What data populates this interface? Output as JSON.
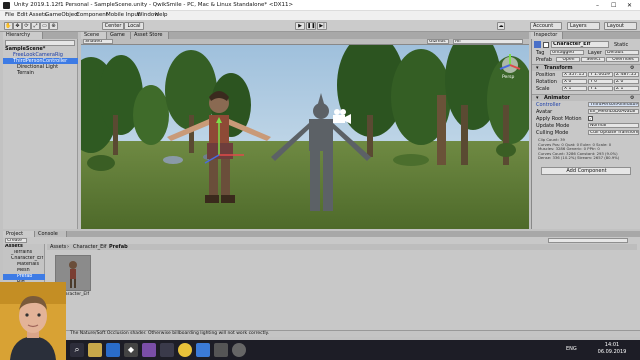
{
  "window": {
    "title": "Unity 2019.1.12f1 Personal - SampleScene.unity - QwikSmile - PC, Mac & Linux Standalone* <DX11>"
  },
  "menu": [
    "File",
    "Edit",
    "Assets",
    "GameObject",
    "Component",
    "Mobile Input",
    "Window",
    "Help"
  ],
  "toolbar": {
    "pivot": "Center",
    "space": "Local",
    "account": "Account",
    "layers": "Layers",
    "layout": "Layout"
  },
  "hierarchy": {
    "tab": "Hierarchy",
    "items": [
      "SampleScene*",
      "FreeLookCameraRig",
      "ThirdPersonController",
      "Directional Light",
      "Terrain"
    ]
  },
  "scene_tabs": [
    "Scene",
    "Game",
    "Asset Store"
  ],
  "scene_toolbar": {
    "shading": "Shaded",
    "gizmos": "Gizmos",
    "search": "All"
  },
  "scene_gizmo": "Persp",
  "inspector": {
    "tab": "Inspector",
    "object_name": "Character_Elf",
    "static_label": "Static",
    "tag_label": "Tag",
    "tag_value": "Untagged",
    "layer_label": "Layer",
    "layer_value": "Default",
    "prefab_label": "Prefab",
    "prefab_open": "Open",
    "prefab_select": "Select",
    "prefab_overrides": "Overrides",
    "transform_title": "Transform",
    "position_label": "Position",
    "position": {
      "x": "X 357.15",
      "y": "Y 1.0029",
      "z": "Z 487.55"
    },
    "rotation_label": "Rotation",
    "rotation": {
      "x": "X 0",
      "y": "Y 0",
      "z": "Z 0"
    },
    "scale_label": "Scale",
    "scale": {
      "x": "X 1",
      "y": "Y 1",
      "z": "Z 1"
    },
    "animator_title": "Animator",
    "controller_label": "Controller",
    "controller_value": "ThirdPersonAnimatorController",
    "avatar_label": "Avatar",
    "avatar_value": "Elf_MeshLoD0Avatar",
    "root_motion_label": "Apply Root Motion",
    "update_mode_label": "Update Mode",
    "update_mode_value": "Normal",
    "culling_label": "Culling Mode",
    "culling_value": "Cull Update Transforms",
    "clip_info": [
      "Clip Count: 39",
      "Curves Pos: 0 Quat: 0 Euler: 0 Scale: 0",
      "Muscles: 3286 Generic: 0 PPtr: 0",
      "Curves Count: 3286 Constant: 293 (9.0%)",
      "Dense: 336 (10.2%) Stream: 2657 (80.9%)"
    ],
    "add_component": "Add Component"
  },
  "project": {
    "tabs": [
      "Project",
      "Console"
    ],
    "create": "Create",
    "breadcrumb": [
      "Assets",
      "Character_Elf",
      "Prefab"
    ],
    "tree": [
      "Assets",
      "_Terrains",
      "Character_Elf",
      "Materials",
      "Mesh",
      "Prefab",
      "Rig",
      "Island",
      "Standard Assets"
    ],
    "asset_label": "Character_Elf"
  },
  "status": {
    "message": "The Nature/Soft Occlusion shader. Otherwise billboarding lighting will not work correctly."
  },
  "taskbar": {
    "lang": "ENG",
    "time": "14:01",
    "date": "06.09.2019"
  },
  "colors": {
    "accent": "#3d7be5",
    "taskbar": "#1d1d26",
    "panel": "#c8c8c8"
  }
}
